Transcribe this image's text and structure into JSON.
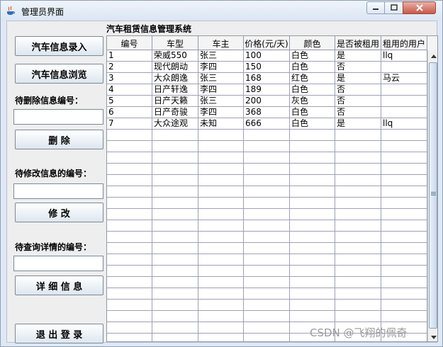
{
  "window": {
    "title": "管理员界面"
  },
  "sidebar": {
    "entry_button": "汽车信息录入",
    "browse_button": "汽车信息浏览",
    "delete_label": "待删除信息编号：",
    "delete_value": "",
    "delete_button": "删    除",
    "modify_label": "待修改信息的编号：",
    "modify_value": "",
    "modify_button": "修    改",
    "detail_label": "待查询详情的编号：",
    "detail_value": "",
    "detail_button": "详 细 信 息",
    "logout_button": "退 出 登 录"
  },
  "main": {
    "title": "汽车租赁信息管理系统",
    "columns": [
      "编号",
      "车型",
      "车主",
      "价格(元/天)",
      "颜色",
      "是否被租用",
      "租用的用户"
    ],
    "rows": [
      [
        "1",
        "荣威550",
        "张三",
        "100",
        "白色",
        "是",
        "llq"
      ],
      [
        "2",
        "现代朗动",
        "李四",
        "150",
        "白色",
        "否",
        ""
      ],
      [
        "3",
        "大众朗逸",
        "张三",
        "168",
        "红色",
        "是",
        "马云"
      ],
      [
        "4",
        "日产轩逸",
        "李四",
        "189",
        "白色",
        "否",
        ""
      ],
      [
        "5",
        "日产天籁",
        "张三",
        "200",
        "灰色",
        "否",
        ""
      ],
      [
        "6",
        "日产奇骏",
        "李四",
        "368",
        "白色",
        "否",
        ""
      ],
      [
        "7",
        "大众途观",
        "未知",
        "666",
        "白色",
        "是",
        "llq"
      ]
    ]
  },
  "watermark": "CSDN @飞翔的佩奇"
}
